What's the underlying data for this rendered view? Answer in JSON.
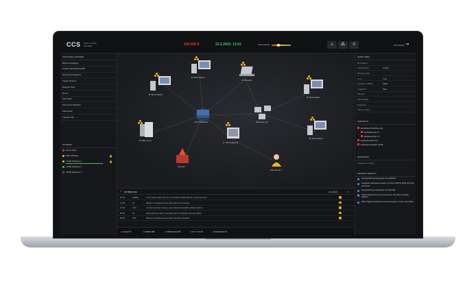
{
  "app": {
    "logo": "CCS",
    "logo_sub": "Cyber Conflict Simulator",
    "money": "100.000 $",
    "datetime": "22.2.2020. 13:53",
    "game_speed_label": "Game speed",
    "user": "User Name"
  },
  "left_panel": {
    "available_actions_title": "AVAILABLE ACTIONS",
    "actions": [
      "Begin Keylogging",
      "Create Spearfishing Mail",
      "Disconnect Machine",
      "Inspect System",
      "Network Scan",
      "Recon",
      "Send Mail",
      "Shut Down Machine",
      "Take Asset",
      "Transfer File"
    ],
    "actions_title": "ACTIONS",
    "history": [
      {
        "label": "Recon Mail",
        "status": "red",
        "lock": false,
        "bar": false
      },
      {
        "label": "Mail Software",
        "status": "yellow",
        "lock": true,
        "bar": false
      },
      {
        "label": "Install Software 1",
        "status": "yellow",
        "lock": true,
        "bar": true
      },
      {
        "label": "Install Software 2",
        "status": "green",
        "lock": false,
        "bar": false
      },
      {
        "label": "Install Software 3",
        "status": "none",
        "lock": false,
        "bar": false
      }
    ]
  },
  "map": {
    "nodes": {
      "ws1": "Work station",
      "ws2": "Work station",
      "camera": "Camera",
      "ws3": "Work station",
      "lan": "LAN Radionica",
      "business": "Business unit",
      "ws4": "Work station",
      "mail": "Mail server",
      "vpn": "VPN Gateway",
      "firewall": "Firewall",
      "employee": "Zaposlenik 4"
    }
  },
  "action_log": {
    "title": "ACTION LOG",
    "date": "22.2.2020.",
    "rows": [
      {
        "time": "13:53",
        "who": "ADMIN",
        "text": "Lorem ipsum dolor sit amet, consectetur adipiscing elit, sed do eiusmod"
      },
      {
        "time": "13:35",
        "who": "AT",
        "text": "Reason: Increased server load, rate limit exceeded"
      },
      {
        "time": "13:03",
        "who": "HCP",
        "text": "Ut enim ad minim veniam, quis nostrud exercitation ullamco laboris"
      },
      {
        "time": "08:00",
        "who": "AT",
        "text": "Duis aute irure dolor in reprehenderit in voluptate velit esse cillum"
      },
      {
        "time": "08:00",
        "who": "HCP",
        "text": "Reason: Increased server load, rate limit exceeded"
      }
    ]
  },
  "bottom_bar": [
    {
      "label": "ALERT",
      "count": "3"
    },
    {
      "label": "INBOX",
      "count": "24"
    },
    {
      "label": "MESSAGE",
      "count": "10"
    },
    {
      "label": "ACT. LOG",
      "count": "5"
    },
    {
      "label": "REQUEST",
      "count": "2"
    }
  ],
  "right_panel": {
    "asset_info_title": "ASSET INFO",
    "info_rows": [
      {
        "k": "Description",
        "v": ""
      },
      {
        "k": "Organization",
        "v": "Center"
      },
      {
        "k": "Physical area",
        "v": ""
      },
      {
        "k": "Is on",
        "v": "True"
      },
      {
        "k": "Location visibility",
        "v": "False"
      },
      {
        "k": "Logged in",
        "v": "Man"
      },
      {
        "k": "OS type",
        "v": ""
      },
      {
        "k": "Vulnerability",
        "v": ""
      },
      {
        "k": "Protocols",
        "v": ""
      },
      {
        "k": "Value in days",
        "v": ""
      }
    ],
    "subjects_title": "SUBJECTS",
    "subjects": [
      {
        "label": "Exfiltrated Workshop file",
        "indent": 0
      },
      {
        "label": "Exfiltrated file T1",
        "indent": 1
      },
      {
        "label": "Exfiltrated file T2",
        "indent": 1
      },
      {
        "label": "Exfiltrated APT file",
        "indent": 0
      },
      {
        "label": "Exfiltrated English HTML",
        "indent": 0
      }
    ],
    "inventory_title": "INVENTORY",
    "inventory_text": "Inventory is empty",
    "shared_title": "SHARED OBJECTS",
    "shared": [
      "Spearphishing kampanja na CARNET",
      "Napadač pokušava ubaciti u mrežnu SMTP, DNS kontrolu potrošnju",
      "Spearphishing kampanja na HAKOM",
      "Cyber Attack Drives com-element. list sites workday adjusts",
      "ABC Zagreb workshop document goes in main, file folder"
    ]
  }
}
